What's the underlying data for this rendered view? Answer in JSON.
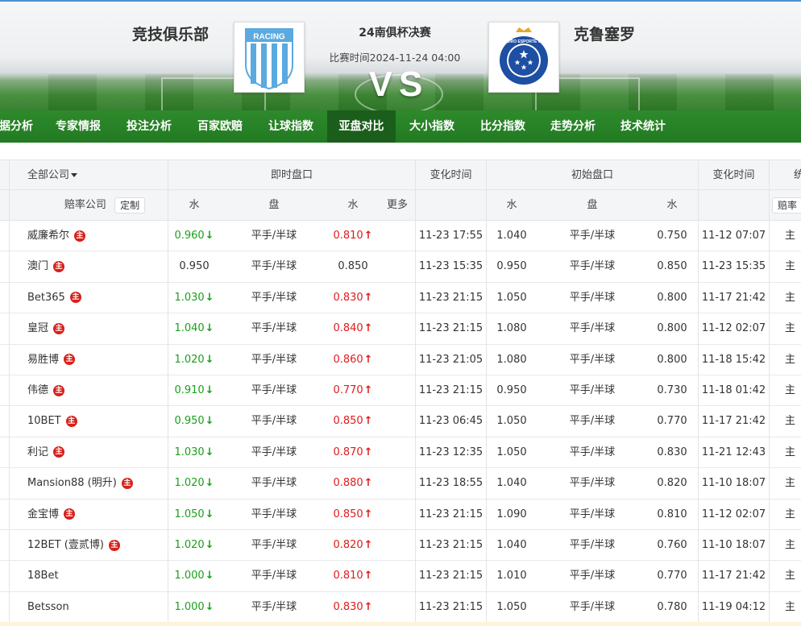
{
  "match": {
    "home_team": "竞技俱乐部",
    "away_team": "克鲁塞罗",
    "competition": "24南俱杯决赛",
    "match_time": "比赛时间2024-11-24 04:00",
    "vs": "VS",
    "home_logo_text": "RACING",
    "away_logo_text": "CRUZEIRO ESPORTE CLUBE"
  },
  "nav": {
    "items": [
      "据分析",
      "专家情报",
      "投注分析",
      "百家欧赔",
      "让球指数",
      "亚盘对比",
      "大小指数",
      "比分指数",
      "走势分析",
      "技术统计"
    ],
    "active_index": 5
  },
  "table": {
    "header1": {
      "company_filter": "全部公司",
      "live_odds": "即时盘口",
      "change_time": "变化时间",
      "initial_odds": "初始盘口",
      "change_time2": "变化时间",
      "stats_partial": "统"
    },
    "header2": {
      "company": "赔率公司",
      "customize": "定制",
      "water1": "水",
      "handicap": "盘",
      "water2": "水",
      "more": "更多",
      "init_water1": "水",
      "init_handicap": "盘",
      "init_water2": "水",
      "right_btn": "赔率"
    },
    "zhu_label": "主",
    "rows": [
      {
        "company": "威廉希尔",
        "zhu": true,
        "w1": "0.960",
        "w1_dir": "down",
        "hc": "平手/半球",
        "w2": "0.810",
        "w2_dir": "up",
        "t1": "11-23 17:55",
        "iw1": "1.040",
        "ihc": "平手/半球",
        "iw2": "0.750",
        "t2": "11-12 07:07"
      },
      {
        "company": "澳门",
        "zhu": true,
        "w1": "0.950",
        "w1_dir": "",
        "hc": "平手/半球",
        "w2": "0.850",
        "w2_dir": "",
        "t1": "11-23 15:35",
        "iw1": "0.950",
        "ihc": "平手/半球",
        "iw2": "0.850",
        "t2": "11-23 15:35"
      },
      {
        "company": "Bet365",
        "zhu": true,
        "w1": "1.030",
        "w1_dir": "down",
        "hc": "平手/半球",
        "w2": "0.830",
        "w2_dir": "up",
        "t1": "11-23 21:15",
        "iw1": "1.050",
        "ihc": "平手/半球",
        "iw2": "0.800",
        "t2": "11-17 21:42"
      },
      {
        "company": "皇冠",
        "zhu": true,
        "w1": "1.040",
        "w1_dir": "down",
        "hc": "平手/半球",
        "w2": "0.840",
        "w2_dir": "up",
        "t1": "11-23 21:15",
        "iw1": "1.080",
        "ihc": "平手/半球",
        "iw2": "0.800",
        "t2": "11-12 02:07"
      },
      {
        "company": "易胜博",
        "zhu": true,
        "w1": "1.020",
        "w1_dir": "down",
        "hc": "平手/半球",
        "w2": "0.860",
        "w2_dir": "up",
        "t1": "11-23 21:05",
        "iw1": "1.080",
        "ihc": "平手/半球",
        "iw2": "0.800",
        "t2": "11-18 15:42"
      },
      {
        "company": "伟德",
        "zhu": true,
        "w1": "0.910",
        "w1_dir": "down",
        "hc": "平手/半球",
        "w2": "0.770",
        "w2_dir": "up",
        "t1": "11-23 21:15",
        "iw1": "0.950",
        "ihc": "平手/半球",
        "iw2": "0.730",
        "t2": "11-18 01:42"
      },
      {
        "company": "10BET",
        "zhu": true,
        "w1": "0.950",
        "w1_dir": "down",
        "hc": "平手/半球",
        "w2": "0.850",
        "w2_dir": "up",
        "t1": "11-23 06:45",
        "iw1": "1.050",
        "ihc": "平手/半球",
        "iw2": "0.770",
        "t2": "11-17 21:42"
      },
      {
        "company": "利记",
        "zhu": true,
        "w1": "1.030",
        "w1_dir": "down",
        "hc": "平手/半球",
        "w2": "0.870",
        "w2_dir": "up",
        "t1": "11-23 12:35",
        "iw1": "1.050",
        "ihc": "平手/半球",
        "iw2": "0.830",
        "t2": "11-21 12:43"
      },
      {
        "company": "Mansion88 (明升)",
        "zhu": true,
        "w1": "1.020",
        "w1_dir": "down",
        "hc": "平手/半球",
        "w2": "0.880",
        "w2_dir": "up",
        "t1": "11-23 18:55",
        "iw1": "1.040",
        "ihc": "平手/半球",
        "iw2": "0.820",
        "t2": "11-10 18:07"
      },
      {
        "company": "金宝博",
        "zhu": true,
        "w1": "1.050",
        "w1_dir": "down",
        "hc": "平手/半球",
        "w2": "0.850",
        "w2_dir": "up",
        "t1": "11-23 21:15",
        "iw1": "1.090",
        "ihc": "平手/半球",
        "iw2": "0.810",
        "t2": "11-12 02:07"
      },
      {
        "company": "12BET (壹贰博)",
        "zhu": true,
        "w1": "1.020",
        "w1_dir": "down",
        "hc": "平手/半球",
        "w2": "0.820",
        "w2_dir": "up",
        "t1": "11-23 21:15",
        "iw1": "1.040",
        "ihc": "平手/半球",
        "iw2": "0.760",
        "t2": "11-10 18:07"
      },
      {
        "company": "18Bet",
        "zhu": false,
        "w1": "1.000",
        "w1_dir": "down",
        "hc": "平手/半球",
        "w2": "0.810",
        "w2_dir": "up",
        "t1": "11-23 21:15",
        "iw1": "1.010",
        "ihc": "平手/半球",
        "iw2": "0.770",
        "t2": "11-17 21:42"
      },
      {
        "company": "Betsson",
        "zhu": false,
        "w1": "1.000",
        "w1_dir": "down",
        "hc": "平手/半球",
        "w2": "0.830",
        "w2_dir": "up",
        "t1": "11-23 21:15",
        "iw1": "1.050",
        "ihc": "平手/半球",
        "iw2": "0.780",
        "t2": "11-19 04:12"
      }
    ],
    "right_col_prefix": "主"
  },
  "colors": {
    "nav_bg": "#2e8a2c",
    "nav_active": "#1b5e1b",
    "down": "#1aa01a",
    "up": "#e01b1b",
    "zhu_badge": "#d8201a"
  }
}
